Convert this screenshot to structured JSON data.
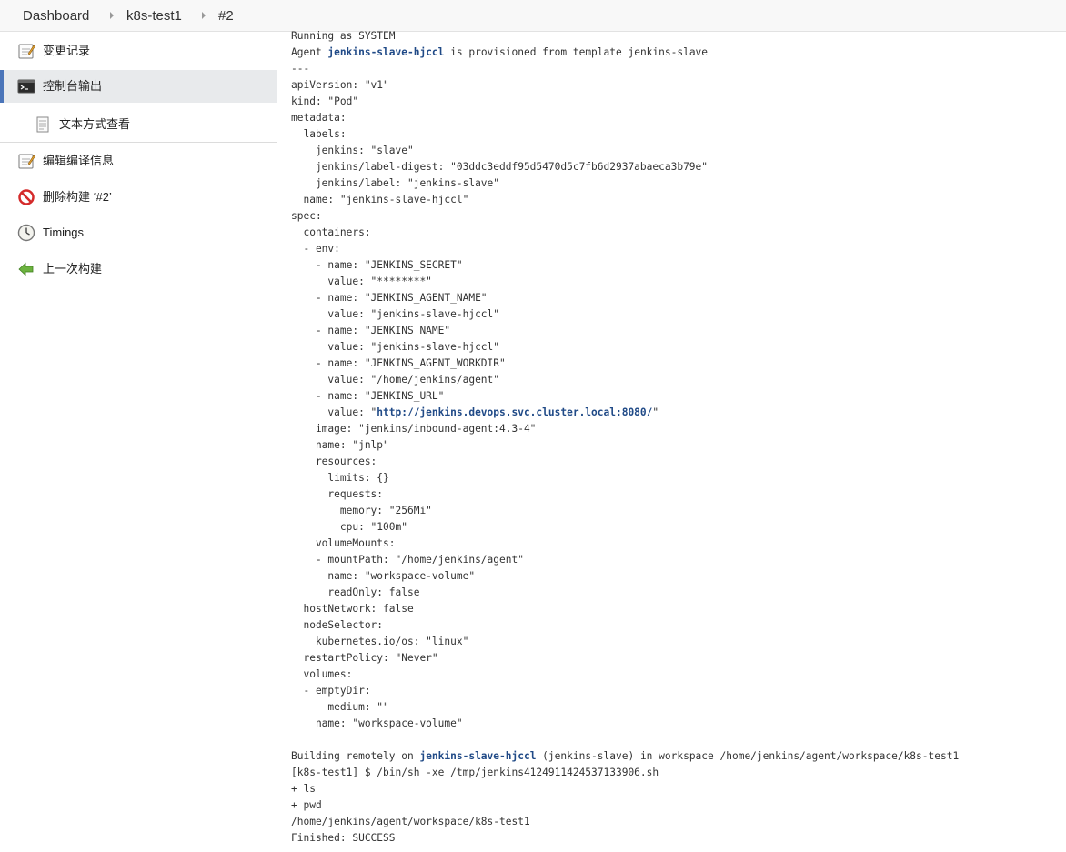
{
  "breadcrumb": {
    "items": [
      "Dashboard",
      "k8s-test1",
      "#2"
    ]
  },
  "sidebar": {
    "items": [
      {
        "label": "变更记录",
        "icon": "notepad-icon"
      },
      {
        "label": "控制台输出",
        "icon": "terminal-icon"
      },
      {
        "label": "文本方式查看",
        "icon": "document-icon"
      },
      {
        "label": "编辑编译信息",
        "icon": "notepad-icon"
      },
      {
        "label": "删除构建 ‘#2’",
        "icon": "no-entry-icon"
      },
      {
        "label": "Timings",
        "icon": "clock-icon"
      },
      {
        "label": "上一次构建",
        "icon": "back-arrow-icon"
      }
    ]
  },
  "console": {
    "lines": [
      {
        "t": "Running as SYSTEM"
      },
      {
        "t": "Agent ",
        "link": "jenkins-slave-hjccl",
        "after": " is provisioned from template jenkins-slave"
      },
      {
        "t": "---"
      },
      {
        "t": "apiVersion: \"v1\""
      },
      {
        "t": "kind: \"Pod\""
      },
      {
        "t": "metadata:"
      },
      {
        "t": "  labels:"
      },
      {
        "t": "    jenkins: \"slave\""
      },
      {
        "t": "    jenkins/label-digest: \"03ddc3eddf95d5470d5c7fb6d2937abaeca3b79e\""
      },
      {
        "t": "    jenkins/label: \"jenkins-slave\""
      },
      {
        "t": "  name: \"jenkins-slave-hjccl\""
      },
      {
        "t": "spec:"
      },
      {
        "t": "  containers:"
      },
      {
        "t": "  - env:"
      },
      {
        "t": "    - name: \"JENKINS_SECRET\""
      },
      {
        "t": "      value: \"********\""
      },
      {
        "t": "    - name: \"JENKINS_AGENT_NAME\""
      },
      {
        "t": "      value: \"jenkins-slave-hjccl\""
      },
      {
        "t": "    - name: \"JENKINS_NAME\""
      },
      {
        "t": "      value: \"jenkins-slave-hjccl\""
      },
      {
        "t": "    - name: \"JENKINS_AGENT_WORKDIR\""
      },
      {
        "t": "      value: \"/home/jenkins/agent\""
      },
      {
        "t": "    - name: \"JENKINS_URL\""
      },
      {
        "t": "      value: \"",
        "link": "http://jenkins.devops.svc.cluster.local:8080/",
        "after": "\""
      },
      {
        "t": "    image: \"jenkins/inbound-agent:4.3-4\""
      },
      {
        "t": "    name: \"jnlp\""
      },
      {
        "t": "    resources:"
      },
      {
        "t": "      limits: {}"
      },
      {
        "t": "      requests:"
      },
      {
        "t": "        memory: \"256Mi\""
      },
      {
        "t": "        cpu: \"100m\""
      },
      {
        "t": "    volumeMounts:"
      },
      {
        "t": "    - mountPath: \"/home/jenkins/agent\""
      },
      {
        "t": "      name: \"workspace-volume\""
      },
      {
        "t": "      readOnly: false"
      },
      {
        "t": "  hostNetwork: false"
      },
      {
        "t": "  nodeSelector:"
      },
      {
        "t": "    kubernetes.io/os: \"linux\""
      },
      {
        "t": "  restartPolicy: \"Never\""
      },
      {
        "t": "  volumes:"
      },
      {
        "t": "  - emptyDir:"
      },
      {
        "t": "      medium: \"\""
      },
      {
        "t": "    name: \"workspace-volume\""
      },
      {
        "t": ""
      },
      {
        "t": "Building remotely on ",
        "link": "jenkins-slave-hjccl",
        "after": " (jenkins-slave) in workspace /home/jenkins/agent/workspace/k8s-test1"
      },
      {
        "t": "[k8s-test1] $ /bin/sh -xe /tmp/jenkins4124911424537133906.sh"
      },
      {
        "t": "+ ls"
      },
      {
        "t": "+ pwd"
      },
      {
        "t": "/home/jenkins/agent/workspace/k8s-test1"
      },
      {
        "t": "Finished: SUCCESS"
      }
    ]
  },
  "colors": {
    "link": "#204a87",
    "active_bar": "#4b75b9",
    "active_bg": "#e8eaec"
  }
}
